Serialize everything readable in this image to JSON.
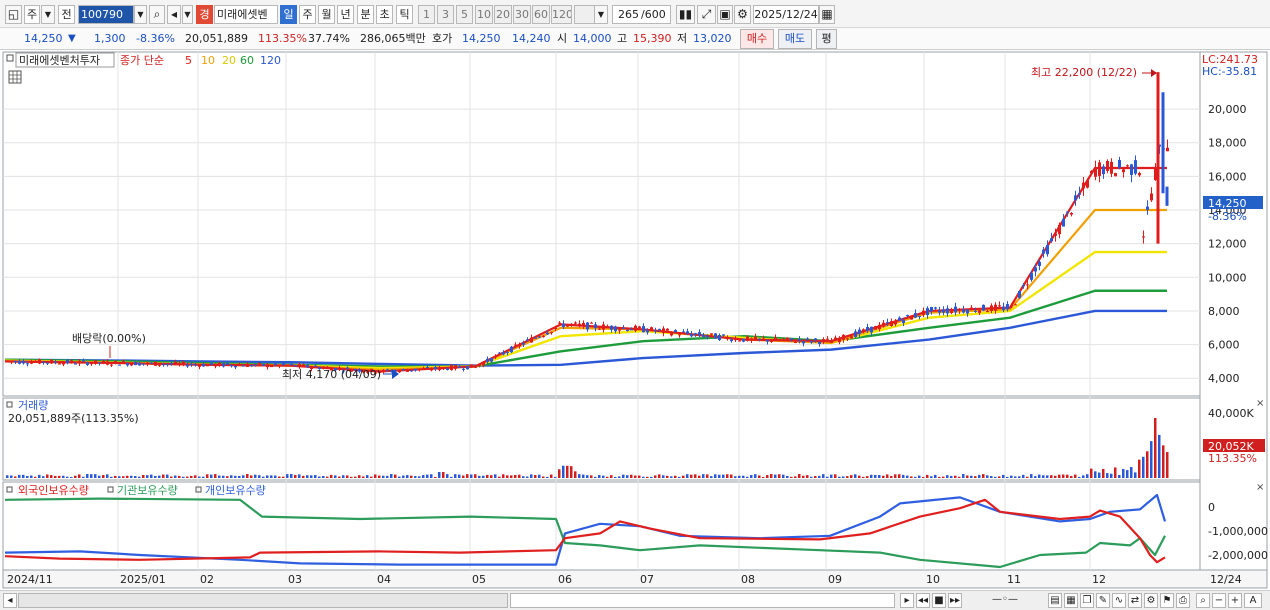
{
  "toolbar": {
    "market": "주",
    "prev": "전",
    "code": "100790",
    "badge": "경",
    "stock_name": "미래에셋벤",
    "periods": [
      "일",
      "주",
      "월",
      "년",
      "분",
      "초",
      "틱"
    ],
    "active_period": "일",
    "ranges": [
      "1",
      "3",
      "5",
      "10",
      "20",
      "30",
      "60",
      "120"
    ],
    "count": "265",
    "count_max": "/600",
    "date": "2025/12/24"
  },
  "price": {
    "current": "14,250",
    "change": "1,300",
    "change_pct": "-8.36%",
    "volume": "20,051,889",
    "volume_ratio": "113.35%",
    "turnover": "37.74%",
    "amount": "286,065백만",
    "bid_label": "호가",
    "ask": "14,250",
    "bid": "14,240",
    "open_label": "시",
    "open": "14,000",
    "high_label": "고",
    "high": "15,390",
    "low_label": "저",
    "low": "13,020",
    "buy_label": "매수",
    "sell_label": "매도",
    "avg_label": "평"
  },
  "main_panel": {
    "title": "미래에셋벤처투자",
    "ma_label": "종가 단순",
    "ma_periods": [
      "5",
      "10",
      "20",
      "60",
      "120"
    ],
    "ma_colors": [
      "#e11c1c",
      "#f0a000",
      "#f2e600",
      "#1e9c3c",
      "#2b58d6"
    ],
    "lc": "LC:241.73",
    "hc": "HC:-35.81",
    "high_annotation": "최고 22,200 (12/22)",
    "low_annotation": "최저 4,170 (04/09)",
    "dividend_annotation": "배당락(0.00%)",
    "last_price": "14,250",
    "last_change": "-8.36%",
    "y_ticks": [
      "20,000",
      "18,000",
      "16,000",
      "14,000",
      "12,000",
      "10,000",
      "8,000",
      "6,000",
      "4,000"
    ]
  },
  "volume_panel": {
    "title": "거래량",
    "value": "20,051,889주(113.35%)",
    "tick": "40,000K",
    "last_value": "20,052K",
    "last_ratio": "113.35%"
  },
  "holding_panel": {
    "legend": [
      "외국인보유수량",
      "기관보유수량",
      "개인보유수량"
    ],
    "colors": [
      "#e0201f",
      "#2b9c5a",
      "#2f5fe0"
    ],
    "y_ticks": [
      "0",
      "-1,000,000",
      "-2,000,000"
    ]
  },
  "x_axis": {
    "labels": [
      "2024/11",
      "2025/01",
      "02",
      "03",
      "04",
      "05",
      "06",
      "07",
      "08",
      "09",
      "10",
      "11",
      "12"
    ],
    "right_label": "12/24"
  },
  "chart_data": {
    "type": "line",
    "title": "미래에셋벤처투자",
    "x": [
      "2024/11",
      "2025/01",
      "02",
      "03",
      "04",
      "05",
      "06",
      "07",
      "08",
      "09",
      "10",
      "11",
      "12"
    ],
    "ylim": [
      4000,
      22200
    ],
    "series": [
      {
        "name": "5",
        "values": [
          5000,
          4900,
          4800,
          4750,
          4400,
          4700,
          7200,
          6900,
          6300,
          6200,
          8000,
          8200,
          16500
        ]
      },
      {
        "name": "10",
        "values": [
          5000,
          4900,
          4800,
          4750,
          4500,
          4700,
          7000,
          6900,
          6300,
          6100,
          7900,
          8100,
          14000
        ]
      },
      {
        "name": "20",
        "values": [
          5050,
          4920,
          4820,
          4760,
          4600,
          4700,
          6500,
          6800,
          6400,
          6100,
          7600,
          8000,
          11500
        ]
      },
      {
        "name": "60",
        "values": [
          5100,
          5000,
          4900,
          4800,
          4700,
          4700,
          5600,
          6200,
          6500,
          6200,
          7000,
          7600,
          9200
        ]
      },
      {
        "name": "120",
        "values": [
          5100,
          5050,
          5000,
          4950,
          4850,
          4750,
          4800,
          5200,
          5500,
          5700,
          6300,
          7000,
          8000
        ]
      }
    ],
    "high": 22200,
    "low": 4170,
    "last": 14250
  }
}
